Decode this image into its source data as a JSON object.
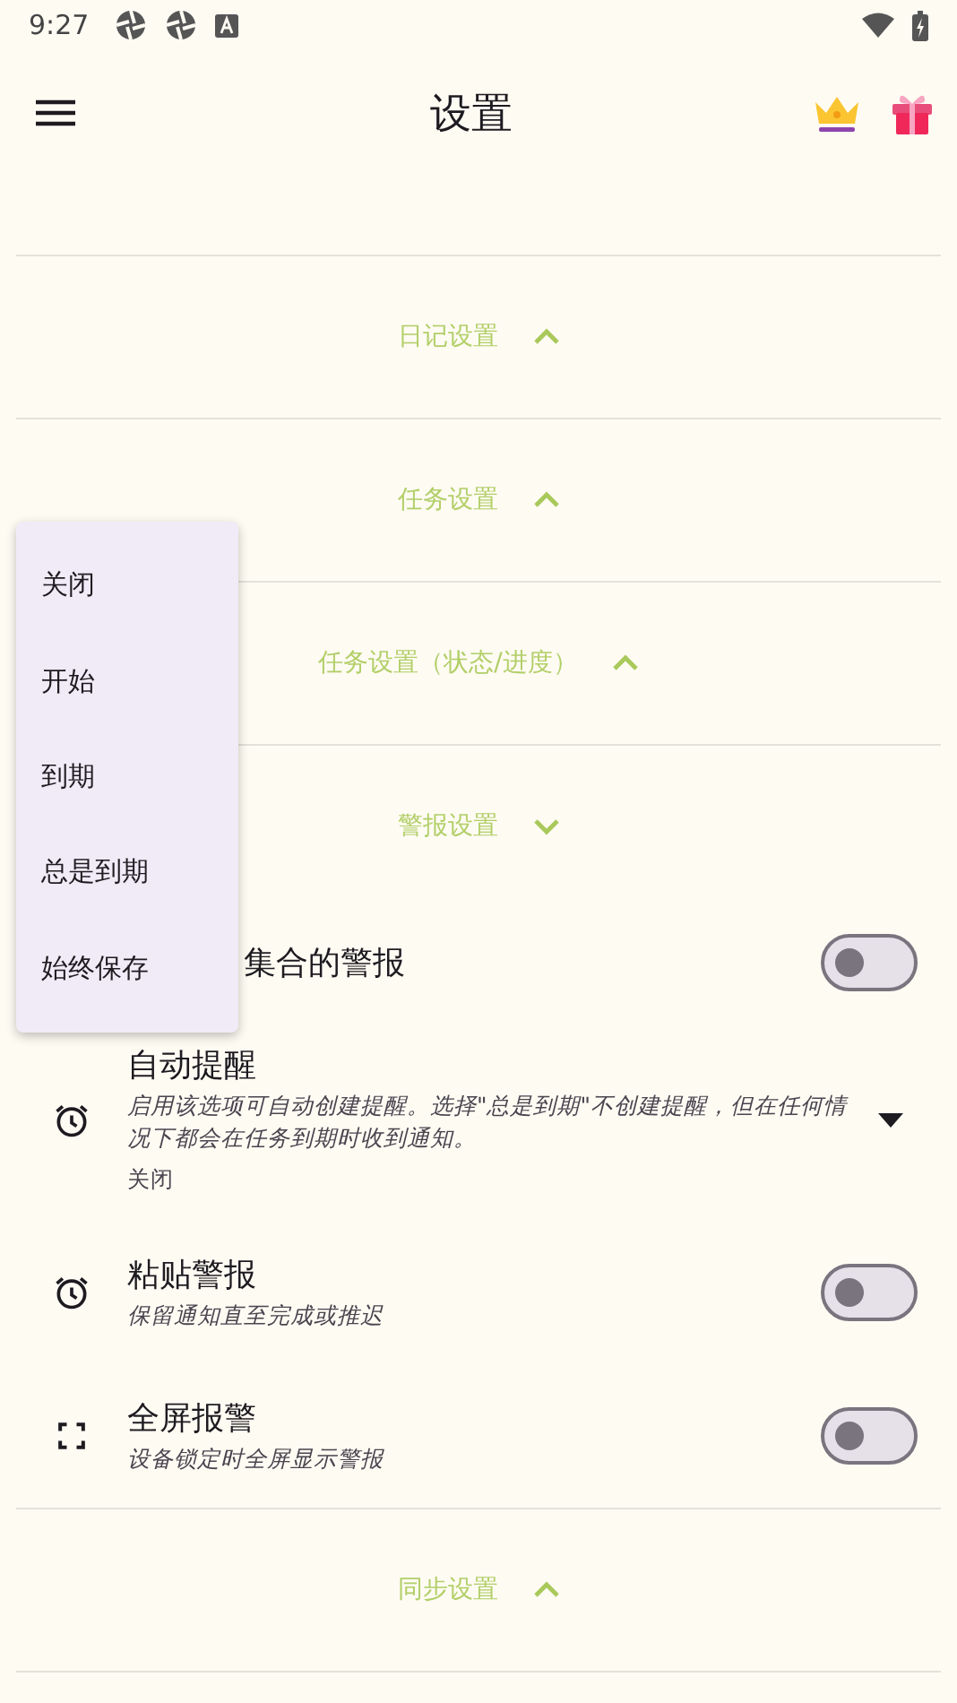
{
  "status_bar": {
    "time": "9:27"
  },
  "app_bar": {
    "title": "设置"
  },
  "sections": [
    {
      "title": "日记设置",
      "expanded": false
    },
    {
      "title": "任务设置",
      "expanded": false
    },
    {
      "title": "任务设置（状态/进度）",
      "expanded": false
    },
    {
      "title": "警报设置",
      "expanded": true,
      "items": [
        {
          "kind": "toggle",
          "title": "集合的警报",
          "on": false
        },
        {
          "kind": "dropdown",
          "title": "自动提醒",
          "description": "启用该选项可自动创建提醒。选择\"总是到期\"不创建提醒，但在任何情况下都会在任务到期时收到通知。",
          "value": "关闭"
        },
        {
          "kind": "toggle",
          "title": "粘贴警报",
          "description": "保留通知直至完成或推迟",
          "on": false
        },
        {
          "kind": "toggle",
          "title": "全屏报警",
          "description": "设备锁定时全屏显示警报",
          "on": false
        }
      ]
    },
    {
      "title": "同步设置",
      "expanded": false
    }
  ],
  "menu": {
    "options": [
      {
        "label": "关闭",
        "selected": false
      },
      {
        "label": "开始",
        "selected": false
      },
      {
        "label": "到期",
        "selected": false
      },
      {
        "label": "总是到期",
        "selected": false
      },
      {
        "label": "始终保存",
        "selected": false
      }
    ]
  }
}
